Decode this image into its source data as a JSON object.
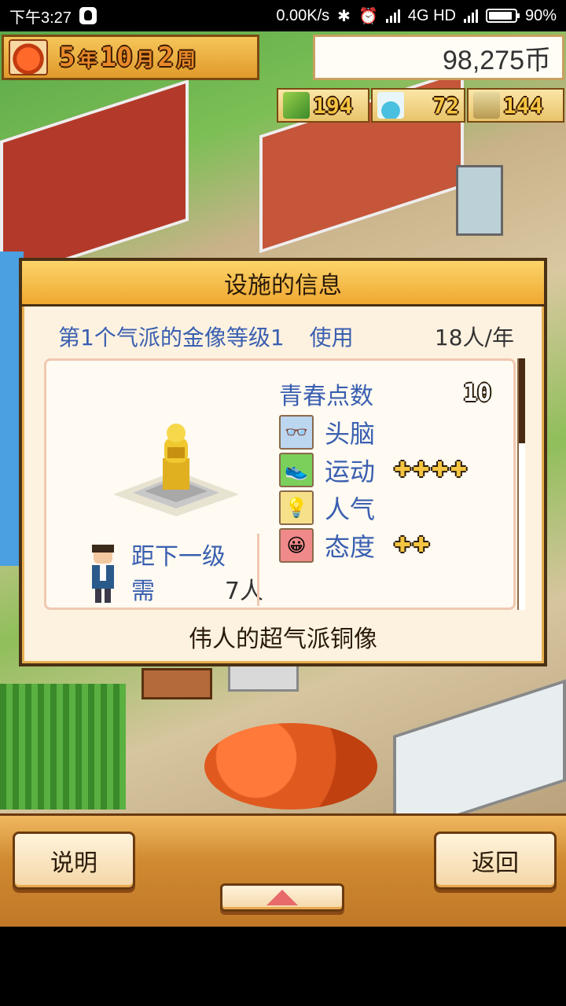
{
  "status_bar": {
    "time": "下午3:27",
    "network_speed": "0.00K/s",
    "network_type": "4G HD",
    "battery": "90%",
    "battery_level": 0.9
  },
  "hud": {
    "year_num": "5",
    "year_unit": "年",
    "month_num": "10",
    "month_unit": "月",
    "week_num": "2",
    "week_unit": "周",
    "money": "98,275币",
    "stat1": "194",
    "stat2": "72",
    "stat3": "144"
  },
  "dialog": {
    "title": "设施的信息",
    "facility_name": "第1个气派的金像等级1",
    "use_label": "使用",
    "use_rate": "18人/年",
    "points_label": "青春点数",
    "points_value": "10",
    "attributes": [
      {
        "name": "头脑",
        "stars": ""
      },
      {
        "name": "运动",
        "stars": "✚✚✚✚"
      },
      {
        "name": "人气",
        "stars": ""
      },
      {
        "name": "态度",
        "stars": "✚✚"
      }
    ],
    "next_level_label": "距下一级",
    "need_label": "需",
    "need_count": "7人",
    "description": "伟人的超气派铜像"
  },
  "buttons": {
    "help": "说明",
    "back": "返回"
  },
  "colors": {
    "accent_blue": "#3a5fb0",
    "title_bar": "#f0a830",
    "frame": "#4a3014"
  }
}
